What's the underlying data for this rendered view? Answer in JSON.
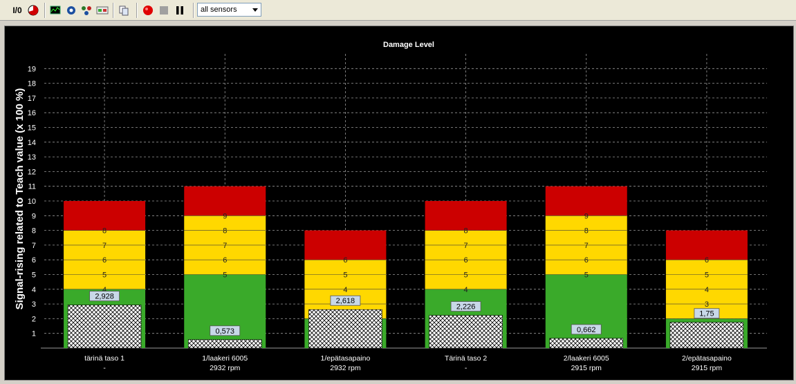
{
  "toolbar": {
    "io_label": "I/0",
    "buttons": [
      "io-icon",
      "pie-icon",
      "monitor-icon",
      "network-icon",
      "nodes-icon",
      "card-icon",
      "copy-icon",
      "record-icon",
      "stop-icon",
      "pause-icon"
    ],
    "sensor_select": {
      "value": "all sensors"
    }
  },
  "chart_data": {
    "type": "bar",
    "title": "Damage Level",
    "ylabel": "Signal-rising related to Teach value (x 100 %)",
    "ylim": [
      0,
      20
    ],
    "yticks": [
      1,
      2,
      3,
      4,
      5,
      6,
      7,
      8,
      9,
      10,
      11,
      12,
      13,
      14,
      15,
      16,
      17,
      18,
      19
    ],
    "grid": true,
    "colors": {
      "green": "#3aaa2a",
      "yellow": "#ffd800",
      "red": "#cc0000"
    },
    "categories": [
      {
        "name": "tärinä taso 1",
        "sub": "-",
        "green_top": 4,
        "yellow_top": 8,
        "red_top": 10,
        "value": 2.928,
        "value_label": "2,928",
        "level_labels": [
          "4",
          "5",
          "6",
          "7",
          "8"
        ]
      },
      {
        "name": "1/laakeri 6005",
        "sub": "2932 rpm",
        "green_top": 5,
        "yellow_top": 9,
        "red_top": 11,
        "value": 0.573,
        "value_label": "0,573",
        "level_labels": [
          "5",
          "6",
          "7",
          "8",
          "9"
        ]
      },
      {
        "name": "1/epätasapaino",
        "sub": "2932 rpm",
        "green_top": 2,
        "yellow_top": 6,
        "red_top": 8,
        "value": 2.618,
        "value_label": "2,618",
        "level_labels": [
          "4",
          "5",
          "6"
        ]
      },
      {
        "name": "Tärinä taso 2",
        "sub": "-",
        "green_top": 4,
        "yellow_top": 8,
        "red_top": 10,
        "value": 2.226,
        "value_label": "2,226",
        "level_labels": [
          "4",
          "5",
          "6",
          "7",
          "8"
        ]
      },
      {
        "name": "2/laakeri 6005",
        "sub": "2915 rpm",
        "green_top": 5,
        "yellow_top": 9,
        "red_top": 11,
        "value": 0.662,
        "value_label": "0,662",
        "level_labels": [
          "5",
          "6",
          "7",
          "8",
          "9"
        ]
      },
      {
        "name": "2/epätasapaino",
        "sub": "2915 rpm",
        "green_top": 2,
        "yellow_top": 6,
        "red_top": 8,
        "value": 1.75,
        "value_label": "1,75",
        "level_labels": [
          "3",
          "4",
          "5",
          "6"
        ]
      }
    ]
  }
}
